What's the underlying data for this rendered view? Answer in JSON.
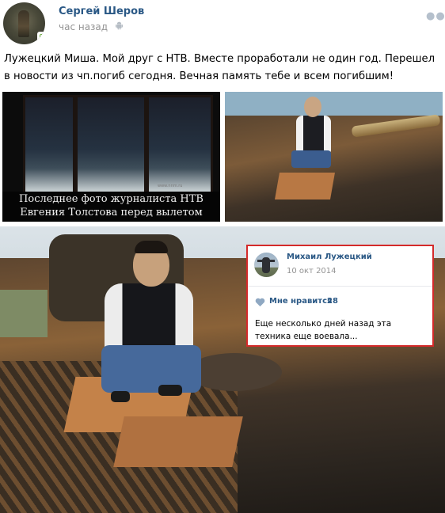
{
  "post": {
    "author": "Сергей Шеров",
    "time": "час назад",
    "text": "Лужецкий Миша. Мой друг с НТВ. Вместе проработали не один год. Перешел в новости из чп.погиб сегодня. Вечная память тебе и всем погибшим!",
    "icons": [
      "online-mobile-icon",
      "android-icon",
      "more-icon"
    ]
  },
  "photo1": {
    "caption_line1": "Последнее фото журналиста НТВ",
    "caption_line2": "Евгения Толстова перед вылетом"
  },
  "embedded_post": {
    "author": "Михаил Лужецкий",
    "date": "10 окт 2014",
    "like_label": "Мне нравится",
    "like_count": "28",
    "text": "Еще несколько дней назад эта техника еще воевала...",
    "border_color": "#d42a2a"
  },
  "colors": {
    "link": "#2a5885",
    "muted": "#939393",
    "online": "#6fae42"
  }
}
